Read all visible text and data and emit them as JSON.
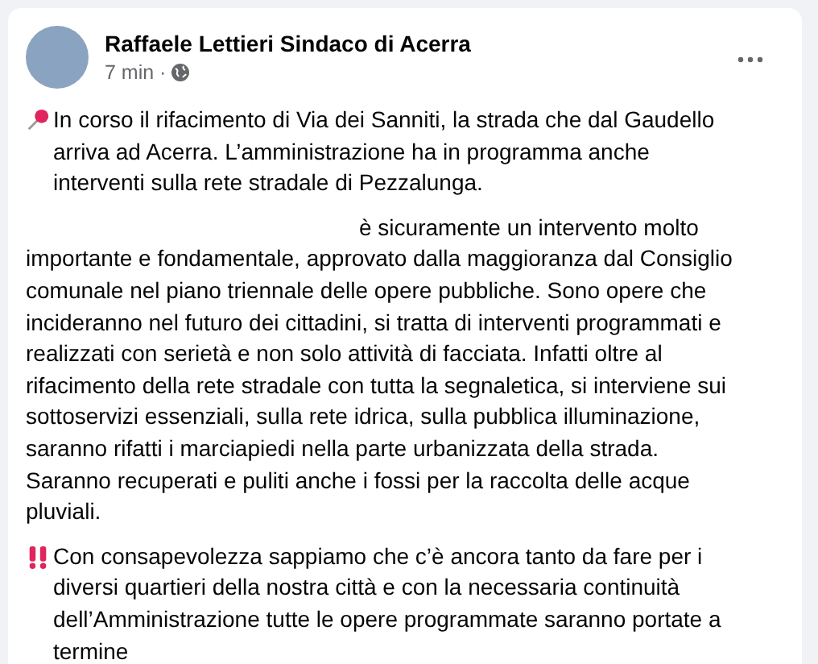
{
  "post": {
    "author": "Raffaele Lettieri Sindaco di Acerra",
    "time": "7 min ·",
    "paragraphs": [
      {
        "kind": "pin",
        "text": "In corso il rifacimento di Via dei Sanniti, la strada che dal Gaudello arriva ad Acerra. L’amministrazione ha in programma anche interventi sulla rete stradale di Pezzalunga."
      },
      {
        "kind": "gap",
        "text": "è sicuramente un intervento molto importante e fondamentale, approvato dalla maggioranza dal Consiglio comunale nel piano triennale delle opere pubbliche. Sono opere che incideranno nel futuro dei cittadini, si tratta di interventi programmati e realizzati con serietà e non solo attività di facciata. Infatti oltre al rifacimento della rete stradale con tutta la segnaletica, si interviene sui sottoservizi essenziali, sulla rete idrica, sulla pubblica illuminazione, saranno rifatti i marciapiedi nella parte urbanizzata della strada. Saranno recuperati e puliti anche i fossi per la raccolta delle acque pluviali."
      },
      {
        "kind": "alert",
        "text": "Con consapevolezza sappiamo che c’è ancora tanto da fare per i diversi quartieri della nostra città e con la necessaria continuità dell’Amministrazione tutte le opere programmate saranno portate a termine"
      }
    ]
  }
}
